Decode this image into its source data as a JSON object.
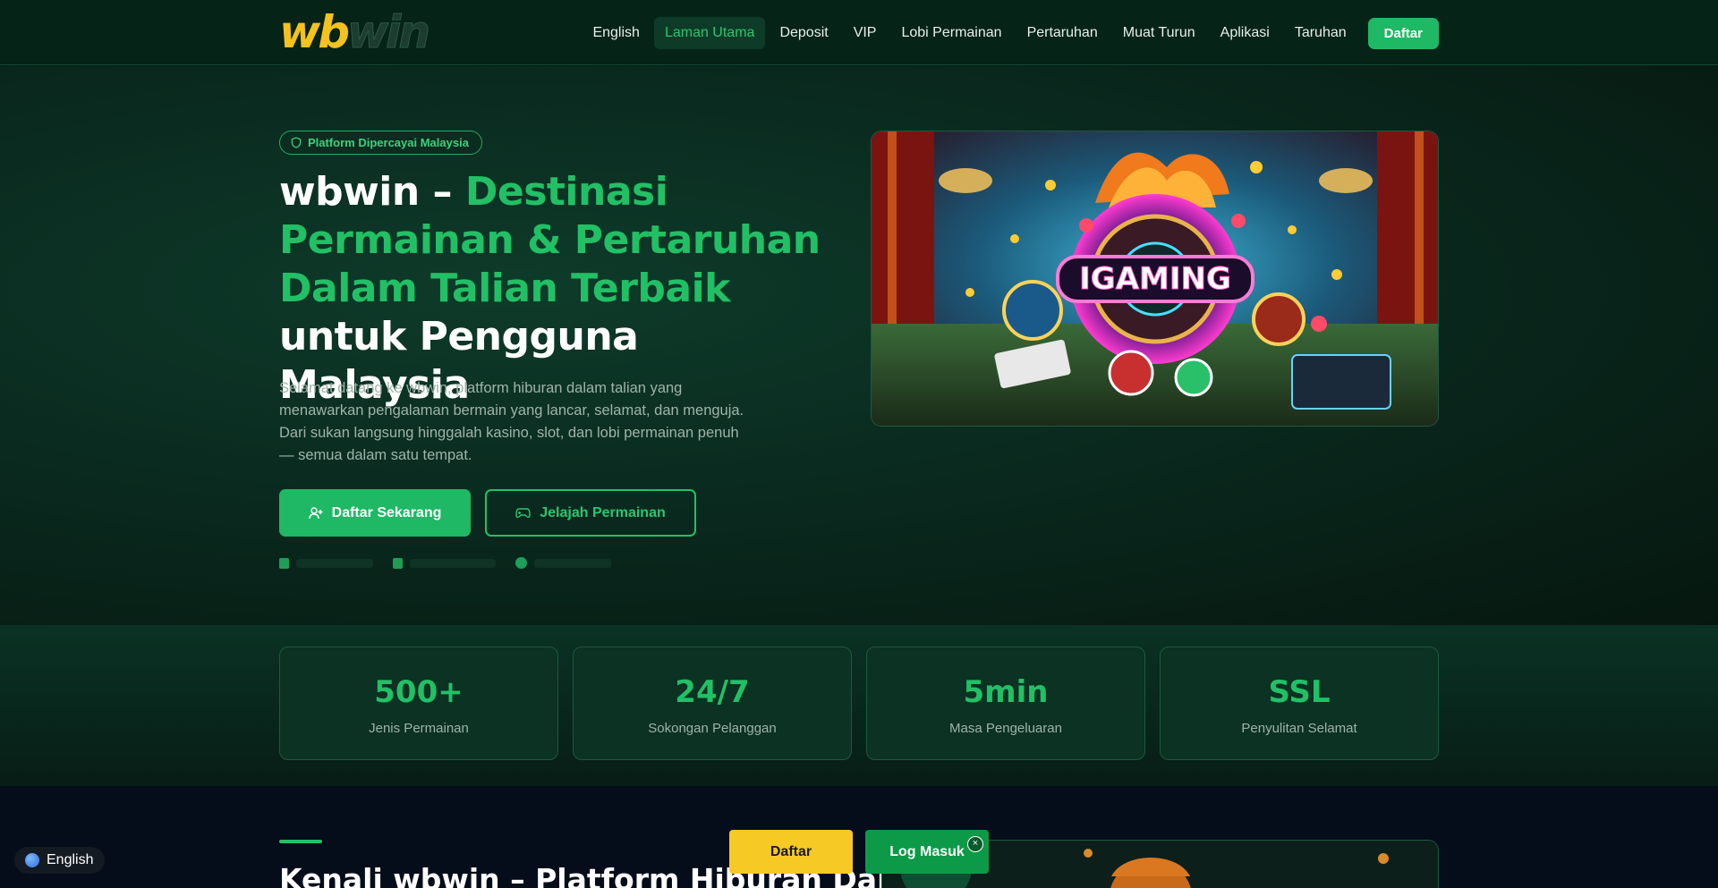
{
  "header": {
    "logo_wb": "wb",
    "logo_win": "win",
    "nav": [
      {
        "label": "English",
        "active": false
      },
      {
        "label": "Laman Utama",
        "active": true
      },
      {
        "label": "Deposit",
        "active": false
      },
      {
        "label": "VIP",
        "active": false
      },
      {
        "label": "Lobi Permainan",
        "active": false
      },
      {
        "label": "Pertaruhan",
        "active": false
      },
      {
        "label": "Muat Turun",
        "active": false
      },
      {
        "label": "Aplikasi",
        "active": false
      },
      {
        "label": "Taruhan",
        "active": false
      }
    ],
    "cta": "Daftar"
  },
  "hero": {
    "badge": "Platform Dipercayai Malaysia",
    "title_white_1": "wbwin – ",
    "title_green": "Destinasi Permainan & Pertaruhan Dalam Talian Terbaik",
    "title_white_2": " untuk Pengguna Malaysia",
    "description": "Selamat datang ke wbwin, platform hiburan dalam talian yang menawarkan pengalaman bermain yang lancar, selamat, dan menguja. Dari sukan langsung hinggalah kasino, slot, dan lobi permainan penuh — semua dalam satu tempat.",
    "btn_primary": "Daftar Sekarang",
    "btn_secondary": "Jelajah Permainan",
    "image_text": "IGAMING"
  },
  "stats": [
    {
      "value": "500+",
      "label": "Jenis Permainan"
    },
    {
      "value": "24/7",
      "label": "Sokongan Pelanggan"
    },
    {
      "value": "5min",
      "label": "Masa Pengeluaran"
    },
    {
      "value": "SSL",
      "label": "Penyulitan Selamat"
    }
  ],
  "section": {
    "title": "Kenali wbwin – Platform Hiburan Dalam"
  },
  "floating": {
    "language": "English",
    "daftar": "Daftar",
    "login": "Log Masuk",
    "close": "×"
  },
  "colors": {
    "accent": "#22c065",
    "brand_yellow": "#f4c21c",
    "background": "#071a14"
  }
}
